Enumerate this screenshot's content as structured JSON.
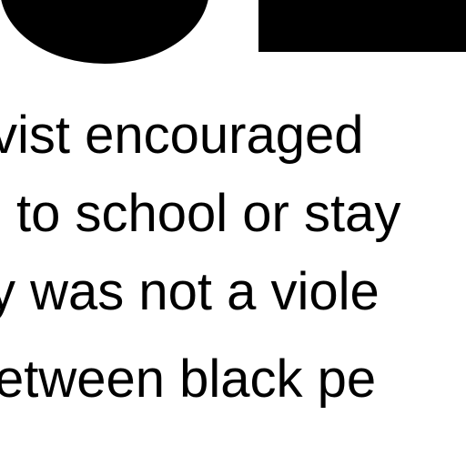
{
  "document": {
    "lines": [
      "vist encouraged",
      "to school or stay",
      "y was not a viole",
      "etween black pe"
    ],
    "colors": {
      "background": "#ffffff",
      "text": "#000000",
      "shapes": "#000000"
    }
  }
}
